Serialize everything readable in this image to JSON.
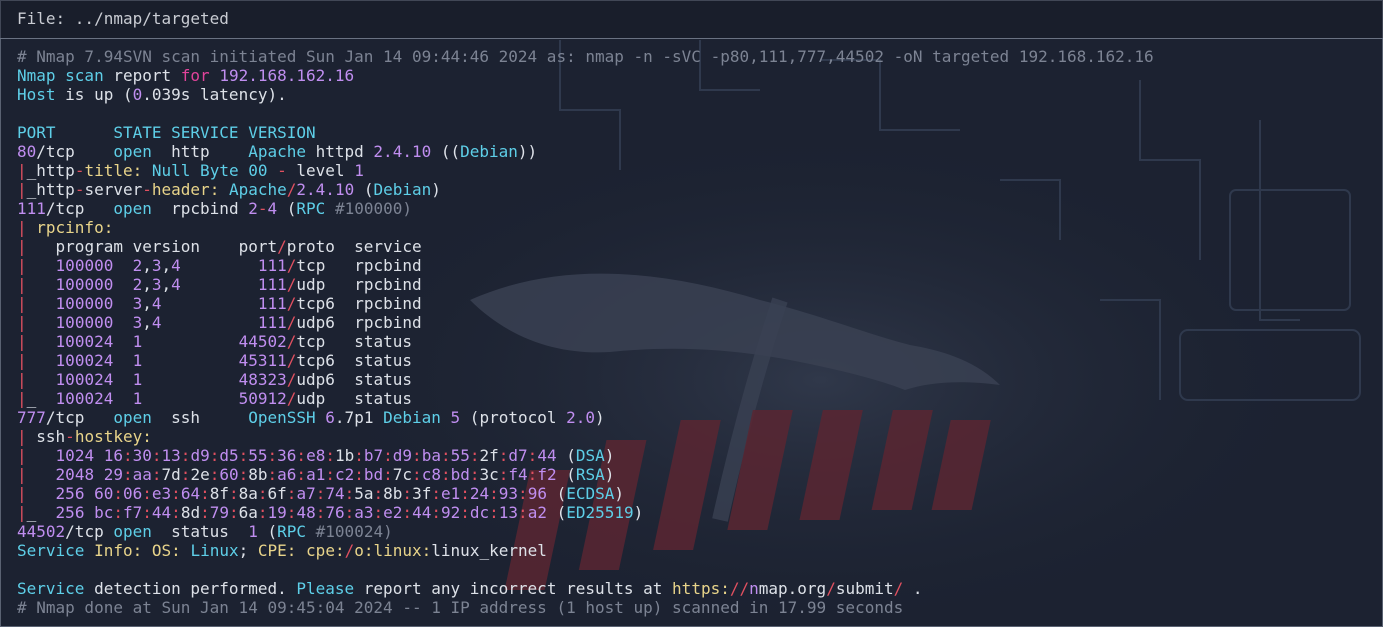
{
  "header": {
    "label": "File: ",
    "path": "../nmap/targeted"
  },
  "lines": [
    [
      [
        "g",
        "# Nmap 7.94SVN scan initiated Sun Jan 14 09:44:46 2024 as: nmap -n -sVC -p80,111,777,44502 -oN targeted 192.168.162.16"
      ]
    ],
    [
      [
        "c",
        "Nmap scan"
      ],
      [
        "w",
        " report "
      ],
      [
        "p",
        "for"
      ],
      [
        "w",
        " "
      ],
      [
        "m",
        "192.168.162.16"
      ]
    ],
    [
      [
        "c",
        "Host"
      ],
      [
        "w",
        " is up ("
      ],
      [
        "m",
        "0"
      ],
      [
        "w",
        ".039s latency)."
      ]
    ],
    [],
    [
      [
        "c",
        "PORT      STATE SERVICE VERSION"
      ]
    ],
    [
      [
        "m",
        "80"
      ],
      [
        "w",
        "/tcp    "
      ],
      [
        "c",
        "open"
      ],
      [
        "w",
        "  http    "
      ],
      [
        "c",
        "Apache"
      ],
      [
        "w",
        " httpd "
      ],
      [
        "m",
        "2.4.10"
      ],
      [
        "w",
        " (("
      ],
      [
        "c",
        "Debian"
      ],
      [
        "w",
        "))"
      ]
    ],
    [
      [
        "r",
        "|"
      ],
      [
        "w",
        "_http"
      ],
      [
        "r",
        "-"
      ],
      [
        "y",
        "title:"
      ],
      [
        "w",
        " "
      ],
      [
        "c",
        "Null Byte 00"
      ],
      [
        "w",
        " "
      ],
      [
        "r",
        "-"
      ],
      [
        "w",
        " level "
      ],
      [
        "m",
        "1"
      ]
    ],
    [
      [
        "r",
        "|"
      ],
      [
        "w",
        "_http"
      ],
      [
        "r",
        "-"
      ],
      [
        "w",
        "server"
      ],
      [
        "r",
        "-"
      ],
      [
        "y",
        "header:"
      ],
      [
        "w",
        " "
      ],
      [
        "c",
        "Apache"
      ],
      [
        "r",
        "/"
      ],
      [
        "m",
        "2.4.10"
      ],
      [
        "w",
        " ("
      ],
      [
        "c",
        "Debian"
      ],
      [
        "w",
        ")"
      ]
    ],
    [
      [
        "m",
        "111"
      ],
      [
        "w",
        "/tcp   "
      ],
      [
        "c",
        "open"
      ],
      [
        "w",
        "  rpcbind "
      ],
      [
        "m",
        "2"
      ],
      [
        "r",
        "-"
      ],
      [
        "m",
        "4"
      ],
      [
        "w",
        " ("
      ],
      [
        "c",
        "RPC"
      ],
      [
        "w",
        " "
      ],
      [
        "g",
        "#100000)"
      ]
    ],
    [
      [
        "r",
        "| "
      ],
      [
        "y",
        "rpcinfo:"
      ]
    ],
    [
      [
        "r",
        "|"
      ],
      [
        "w",
        "   program version    port"
      ],
      [
        "r",
        "/"
      ],
      [
        "w",
        "proto  service"
      ]
    ],
    [
      [
        "r",
        "|"
      ],
      [
        "w",
        "   "
      ],
      [
        "m",
        "100000"
      ],
      [
        "w",
        "  "
      ],
      [
        "m",
        "2"
      ],
      [
        "w",
        ","
      ],
      [
        "m",
        "3"
      ],
      [
        "w",
        ","
      ],
      [
        "m",
        "4"
      ],
      [
        "w",
        "        "
      ],
      [
        "m",
        "111"
      ],
      [
        "r",
        "/"
      ],
      [
        "w",
        "tcp   rpcbind"
      ]
    ],
    [
      [
        "r",
        "|"
      ],
      [
        "w",
        "   "
      ],
      [
        "m",
        "100000"
      ],
      [
        "w",
        "  "
      ],
      [
        "m",
        "2"
      ],
      [
        "w",
        ","
      ],
      [
        "m",
        "3"
      ],
      [
        "w",
        ","
      ],
      [
        "m",
        "4"
      ],
      [
        "w",
        "        "
      ],
      [
        "m",
        "111"
      ],
      [
        "r",
        "/"
      ],
      [
        "w",
        "udp   rpcbind"
      ]
    ],
    [
      [
        "r",
        "|"
      ],
      [
        "w",
        "   "
      ],
      [
        "m",
        "100000"
      ],
      [
        "w",
        "  "
      ],
      [
        "m",
        "3"
      ],
      [
        "w",
        ","
      ],
      [
        "m",
        "4"
      ],
      [
        "w",
        "          "
      ],
      [
        "m",
        "111"
      ],
      [
        "r",
        "/"
      ],
      [
        "w",
        "tcp6  rpcbind"
      ]
    ],
    [
      [
        "r",
        "|"
      ],
      [
        "w",
        "   "
      ],
      [
        "m",
        "100000"
      ],
      [
        "w",
        "  "
      ],
      [
        "m",
        "3"
      ],
      [
        "w",
        ","
      ],
      [
        "m",
        "4"
      ],
      [
        "w",
        "          "
      ],
      [
        "m",
        "111"
      ],
      [
        "r",
        "/"
      ],
      [
        "w",
        "udp6  rpcbind"
      ]
    ],
    [
      [
        "r",
        "|"
      ],
      [
        "w",
        "   "
      ],
      [
        "m",
        "100024"
      ],
      [
        "w",
        "  "
      ],
      [
        "m",
        "1"
      ],
      [
        "w",
        "          "
      ],
      [
        "m",
        "44502"
      ],
      [
        "r",
        "/"
      ],
      [
        "w",
        "tcp   status"
      ]
    ],
    [
      [
        "r",
        "|"
      ],
      [
        "w",
        "   "
      ],
      [
        "m",
        "100024"
      ],
      [
        "w",
        "  "
      ],
      [
        "m",
        "1"
      ],
      [
        "w",
        "          "
      ],
      [
        "m",
        "45311"
      ],
      [
        "r",
        "/"
      ],
      [
        "w",
        "tcp6  status"
      ]
    ],
    [
      [
        "r",
        "|"
      ],
      [
        "w",
        "   "
      ],
      [
        "m",
        "100024"
      ],
      [
        "w",
        "  "
      ],
      [
        "m",
        "1"
      ],
      [
        "w",
        "          "
      ],
      [
        "m",
        "48323"
      ],
      [
        "r",
        "/"
      ],
      [
        "w",
        "udp6  status"
      ]
    ],
    [
      [
        "r",
        "|"
      ],
      [
        "w",
        "_  "
      ],
      [
        "m",
        "100024"
      ],
      [
        "w",
        "  "
      ],
      [
        "m",
        "1"
      ],
      [
        "w",
        "          "
      ],
      [
        "m",
        "50912"
      ],
      [
        "r",
        "/"
      ],
      [
        "w",
        "udp   status"
      ]
    ],
    [
      [
        "m",
        "777"
      ],
      [
        "w",
        "/tcp   "
      ],
      [
        "c",
        "open"
      ],
      [
        "w",
        "  ssh     "
      ],
      [
        "c",
        "OpenSSH"
      ],
      [
        "w",
        " "
      ],
      [
        "m",
        "6"
      ],
      [
        "w",
        ".7p1 "
      ],
      [
        "c",
        "Debian"
      ],
      [
        "w",
        " "
      ],
      [
        "m",
        "5"
      ],
      [
        "w",
        " (protocol "
      ],
      [
        "m",
        "2.0"
      ],
      [
        "w",
        ")"
      ]
    ],
    [
      [
        "r",
        "| "
      ],
      [
        "w",
        "ssh"
      ],
      [
        "r",
        "-"
      ],
      [
        "y",
        "hostkey:"
      ]
    ],
    [
      [
        "r",
        "|"
      ],
      [
        "w",
        "   "
      ],
      [
        "m",
        "1024"
      ],
      [
        "w",
        " "
      ],
      [
        "m",
        "16"
      ],
      [
        "r",
        ":"
      ],
      [
        "m",
        "30"
      ],
      [
        "r",
        ":"
      ],
      [
        "m",
        "13"
      ],
      [
        "r",
        ":"
      ],
      [
        "m",
        "d9"
      ],
      [
        "r",
        ":"
      ],
      [
        "m",
        "d5"
      ],
      [
        "r",
        ":"
      ],
      [
        "m",
        "55"
      ],
      [
        "r",
        ":"
      ],
      [
        "m",
        "36"
      ],
      [
        "r",
        ":"
      ],
      [
        "m",
        "e8"
      ],
      [
        "r",
        ":"
      ],
      [
        "w",
        "1b"
      ],
      [
        "r",
        ":"
      ],
      [
        "m",
        "b7"
      ],
      [
        "r",
        ":"
      ],
      [
        "m",
        "d9"
      ],
      [
        "r",
        ":"
      ],
      [
        "m",
        "ba"
      ],
      [
        "r",
        ":"
      ],
      [
        "m",
        "55"
      ],
      [
        "r",
        ":"
      ],
      [
        "w",
        "2f"
      ],
      [
        "r",
        ":"
      ],
      [
        "m",
        "d7"
      ],
      [
        "r",
        ":"
      ],
      [
        "m",
        "44"
      ],
      [
        "w",
        " ("
      ],
      [
        "c",
        "DSA"
      ],
      [
        "w",
        ")"
      ]
    ],
    [
      [
        "r",
        "|"
      ],
      [
        "w",
        "   "
      ],
      [
        "m",
        "2048"
      ],
      [
        "w",
        " "
      ],
      [
        "m",
        "29"
      ],
      [
        "r",
        ":"
      ],
      [
        "m",
        "aa"
      ],
      [
        "r",
        ":"
      ],
      [
        "w",
        "7d"
      ],
      [
        "r",
        ":"
      ],
      [
        "w",
        "2e"
      ],
      [
        "r",
        ":"
      ],
      [
        "m",
        "60"
      ],
      [
        "r",
        ":"
      ],
      [
        "w",
        "8b"
      ],
      [
        "r",
        ":"
      ],
      [
        "m",
        "a6"
      ],
      [
        "r",
        ":"
      ],
      [
        "m",
        "a1"
      ],
      [
        "r",
        ":"
      ],
      [
        "m",
        "c2"
      ],
      [
        "r",
        ":"
      ],
      [
        "m",
        "bd"
      ],
      [
        "r",
        ":"
      ],
      [
        "w",
        "7c"
      ],
      [
        "r",
        ":"
      ],
      [
        "m",
        "c8"
      ],
      [
        "r",
        ":"
      ],
      [
        "m",
        "bd"
      ],
      [
        "r",
        ":"
      ],
      [
        "w",
        "3c"
      ],
      [
        "r",
        ":"
      ],
      [
        "m",
        "f4"
      ],
      [
        "r",
        ":"
      ],
      [
        "m",
        "f2"
      ],
      [
        "w",
        " ("
      ],
      [
        "c",
        "RSA"
      ],
      [
        "w",
        ")"
      ]
    ],
    [
      [
        "r",
        "|"
      ],
      [
        "w",
        "   "
      ],
      [
        "m",
        "256"
      ],
      [
        "w",
        " "
      ],
      [
        "m",
        "60"
      ],
      [
        "r",
        ":"
      ],
      [
        "m",
        "06"
      ],
      [
        "r",
        ":"
      ],
      [
        "m",
        "e3"
      ],
      [
        "r",
        ":"
      ],
      [
        "m",
        "64"
      ],
      [
        "r",
        ":"
      ],
      [
        "w",
        "8f"
      ],
      [
        "r",
        ":"
      ],
      [
        "w",
        "8a"
      ],
      [
        "r",
        ":"
      ],
      [
        "w",
        "6f"
      ],
      [
        "r",
        ":"
      ],
      [
        "m",
        "a7"
      ],
      [
        "r",
        ":"
      ],
      [
        "m",
        "74"
      ],
      [
        "r",
        ":"
      ],
      [
        "w",
        "5a"
      ],
      [
        "r",
        ":"
      ],
      [
        "w",
        "8b"
      ],
      [
        "r",
        ":"
      ],
      [
        "w",
        "3f"
      ],
      [
        "r",
        ":"
      ],
      [
        "m",
        "e1"
      ],
      [
        "r",
        ":"
      ],
      [
        "m",
        "24"
      ],
      [
        "r",
        ":"
      ],
      [
        "m",
        "93"
      ],
      [
        "r",
        ":"
      ],
      [
        "m",
        "96"
      ],
      [
        "w",
        " ("
      ],
      [
        "c",
        "ECDSA"
      ],
      [
        "w",
        ")"
      ]
    ],
    [
      [
        "r",
        "|"
      ],
      [
        "w",
        "_  "
      ],
      [
        "m",
        "256"
      ],
      [
        "w",
        " "
      ],
      [
        "m",
        "bc"
      ],
      [
        "r",
        ":"
      ],
      [
        "m",
        "f7"
      ],
      [
        "r",
        ":"
      ],
      [
        "m",
        "44"
      ],
      [
        "r",
        ":"
      ],
      [
        "w",
        "8d"
      ],
      [
        "r",
        ":"
      ],
      [
        "m",
        "79"
      ],
      [
        "r",
        ":"
      ],
      [
        "w",
        "6a"
      ],
      [
        "r",
        ":"
      ],
      [
        "m",
        "19"
      ],
      [
        "r",
        ":"
      ],
      [
        "m",
        "48"
      ],
      [
        "r",
        ":"
      ],
      [
        "m",
        "76"
      ],
      [
        "r",
        ":"
      ],
      [
        "m",
        "a3"
      ],
      [
        "r",
        ":"
      ],
      [
        "m",
        "e2"
      ],
      [
        "r",
        ":"
      ],
      [
        "m",
        "44"
      ],
      [
        "r",
        ":"
      ],
      [
        "m",
        "92"
      ],
      [
        "r",
        ":"
      ],
      [
        "m",
        "dc"
      ],
      [
        "r",
        ":"
      ],
      [
        "m",
        "13"
      ],
      [
        "r",
        ":"
      ],
      [
        "m",
        "a2"
      ],
      [
        "w",
        " ("
      ],
      [
        "c",
        "ED25519"
      ],
      [
        "w",
        ")"
      ]
    ],
    [
      [
        "m",
        "44502"
      ],
      [
        "w",
        "/tcp "
      ],
      [
        "c",
        "open"
      ],
      [
        "w",
        "  status  "
      ],
      [
        "m",
        "1"
      ],
      [
        "w",
        " ("
      ],
      [
        "c",
        "RPC"
      ],
      [
        "w",
        " "
      ],
      [
        "g",
        "#100024)"
      ]
    ],
    [
      [
        "c",
        "Service"
      ],
      [
        "w",
        " "
      ],
      [
        "y",
        "Info:"
      ],
      [
        "w",
        " "
      ],
      [
        "y",
        "OS:"
      ],
      [
        "w",
        " "
      ],
      [
        "c",
        "Linux"
      ],
      [
        "w",
        "; "
      ],
      [
        "y",
        "CPE:"
      ],
      [
        "w",
        " "
      ],
      [
        "y",
        "cpe:"
      ],
      [
        "r",
        "/"
      ],
      [
        "y",
        "o:"
      ],
      [
        "y",
        "linux:"
      ],
      [
        "w",
        "linux_kernel"
      ]
    ],
    [],
    [
      [
        "c",
        "Service"
      ],
      [
        "w",
        " detection performed. "
      ],
      [
        "c",
        "Please"
      ],
      [
        "w",
        " report any incorrect results at "
      ],
      [
        "y",
        "https:"
      ],
      [
        "r",
        "//"
      ],
      [
        "m",
        "n"
      ],
      [
        "w",
        "map.org"
      ],
      [
        "r",
        "/"
      ],
      [
        "w",
        "submit"
      ],
      [
        "r",
        "/"
      ],
      [
        "w",
        " ."
      ]
    ],
    [
      [
        "g",
        "# Nmap done at Sun Jan 14 09:45:04 2024 -- 1 IP address (1 host up) scanned in 17.99 seconds"
      ]
    ]
  ]
}
